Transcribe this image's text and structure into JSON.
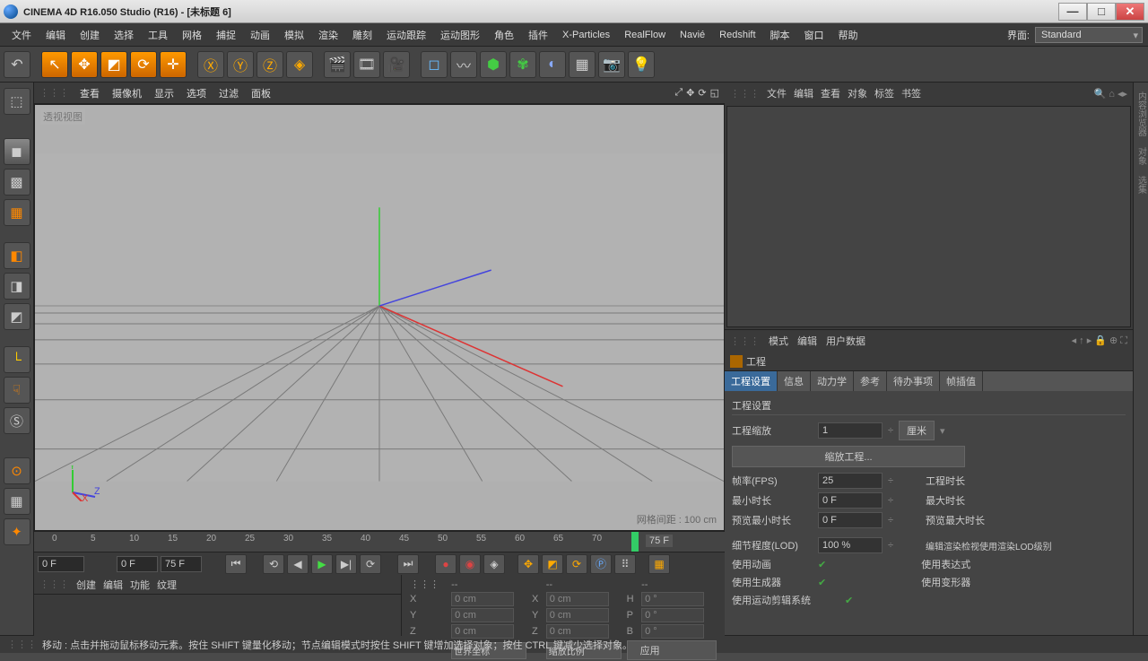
{
  "titlebar": {
    "title": "CINEMA 4D R16.050 Studio (R16) - [未标题 6]"
  },
  "menubar": {
    "items": [
      "文件",
      "编辑",
      "创建",
      "选择",
      "工具",
      "网格",
      "捕捉",
      "动画",
      "模拟",
      "渲染",
      "雕刻",
      "运动跟踪",
      "运动图形",
      "角色",
      "插件",
      "X-Particles",
      "RealFlow",
      "Navié",
      "Redshift",
      "脚本",
      "窗口",
      "帮助"
    ],
    "layoutLabel": "界面:",
    "layoutValue": "Standard"
  },
  "viewport": {
    "menu": [
      "查看",
      "摄像机",
      "显示",
      "选项",
      "过滤",
      "面板"
    ],
    "label": "透视视图",
    "footer": "网格间距 : 100 cm"
  },
  "timeline": {
    "ticks": [
      "0",
      "5",
      "10",
      "15",
      "20",
      "25",
      "30",
      "35",
      "40",
      "45",
      "50",
      "55",
      "60",
      "65",
      "70"
    ],
    "currentFrame": "75 F",
    "start": "0 F",
    "startIn": "0 F",
    "endIn": "75 F"
  },
  "lowerMenu": [
    "创建",
    "编辑",
    "功能",
    "纹理"
  ],
  "coord": {
    "header": [
      "--",
      "--",
      "--"
    ],
    "rows": [
      [
        "X",
        "0 cm",
        "X",
        "0 cm",
        "H",
        "0 °"
      ],
      [
        "Y",
        "0 cm",
        "Y",
        "0 cm",
        "P",
        "0 °"
      ],
      [
        "Z",
        "0 cm",
        "Z",
        "0 cm",
        "B",
        "0 °"
      ]
    ],
    "modeA": "世界坐标",
    "modeB": "缩放比例",
    "apply": "应用"
  },
  "objmgr": {
    "menu": [
      "文件",
      "编辑",
      "查看",
      "对象",
      "标签",
      "书签"
    ]
  },
  "attrmgr": {
    "menu": [
      "模式",
      "编辑",
      "用户数据"
    ],
    "title": "工程",
    "tabs": [
      "工程设置",
      "信息",
      "动力学",
      "参考",
      "待办事项",
      "帧插值"
    ],
    "section": "工程设置",
    "projScale": {
      "label": "工程缩放",
      "value": "1",
      "unit": "厘米"
    },
    "scaleBtn": "缩放工程...",
    "fps": {
      "label": "帧率(FPS)",
      "value": "25"
    },
    "projTime": "工程时长",
    "minTime": {
      "label": "最小时长",
      "value": "0 F"
    },
    "maxTime": "最大时长",
    "prevMin": {
      "label": "预览最小时长",
      "value": "0 F"
    },
    "prevMax": "预览最大时长",
    "lod": {
      "label": "细节程度(LOD)",
      "value": "100 %"
    },
    "lodRight": "编辑渲染检视使用渲染LOD级别",
    "useAnim": "使用动画",
    "useExpr": "使用表达式",
    "useGen": "使用生成器",
    "useDef": "使用变形器",
    "useMot": "使用运动剪辑系统"
  },
  "status": "移动 : 点击并拖动鼠标移动元素。按住 SHIFT 键量化移动；节点编辑模式时按住 SHIFT 键增加选择对象；按住 CTRL 键减少选择对象。"
}
